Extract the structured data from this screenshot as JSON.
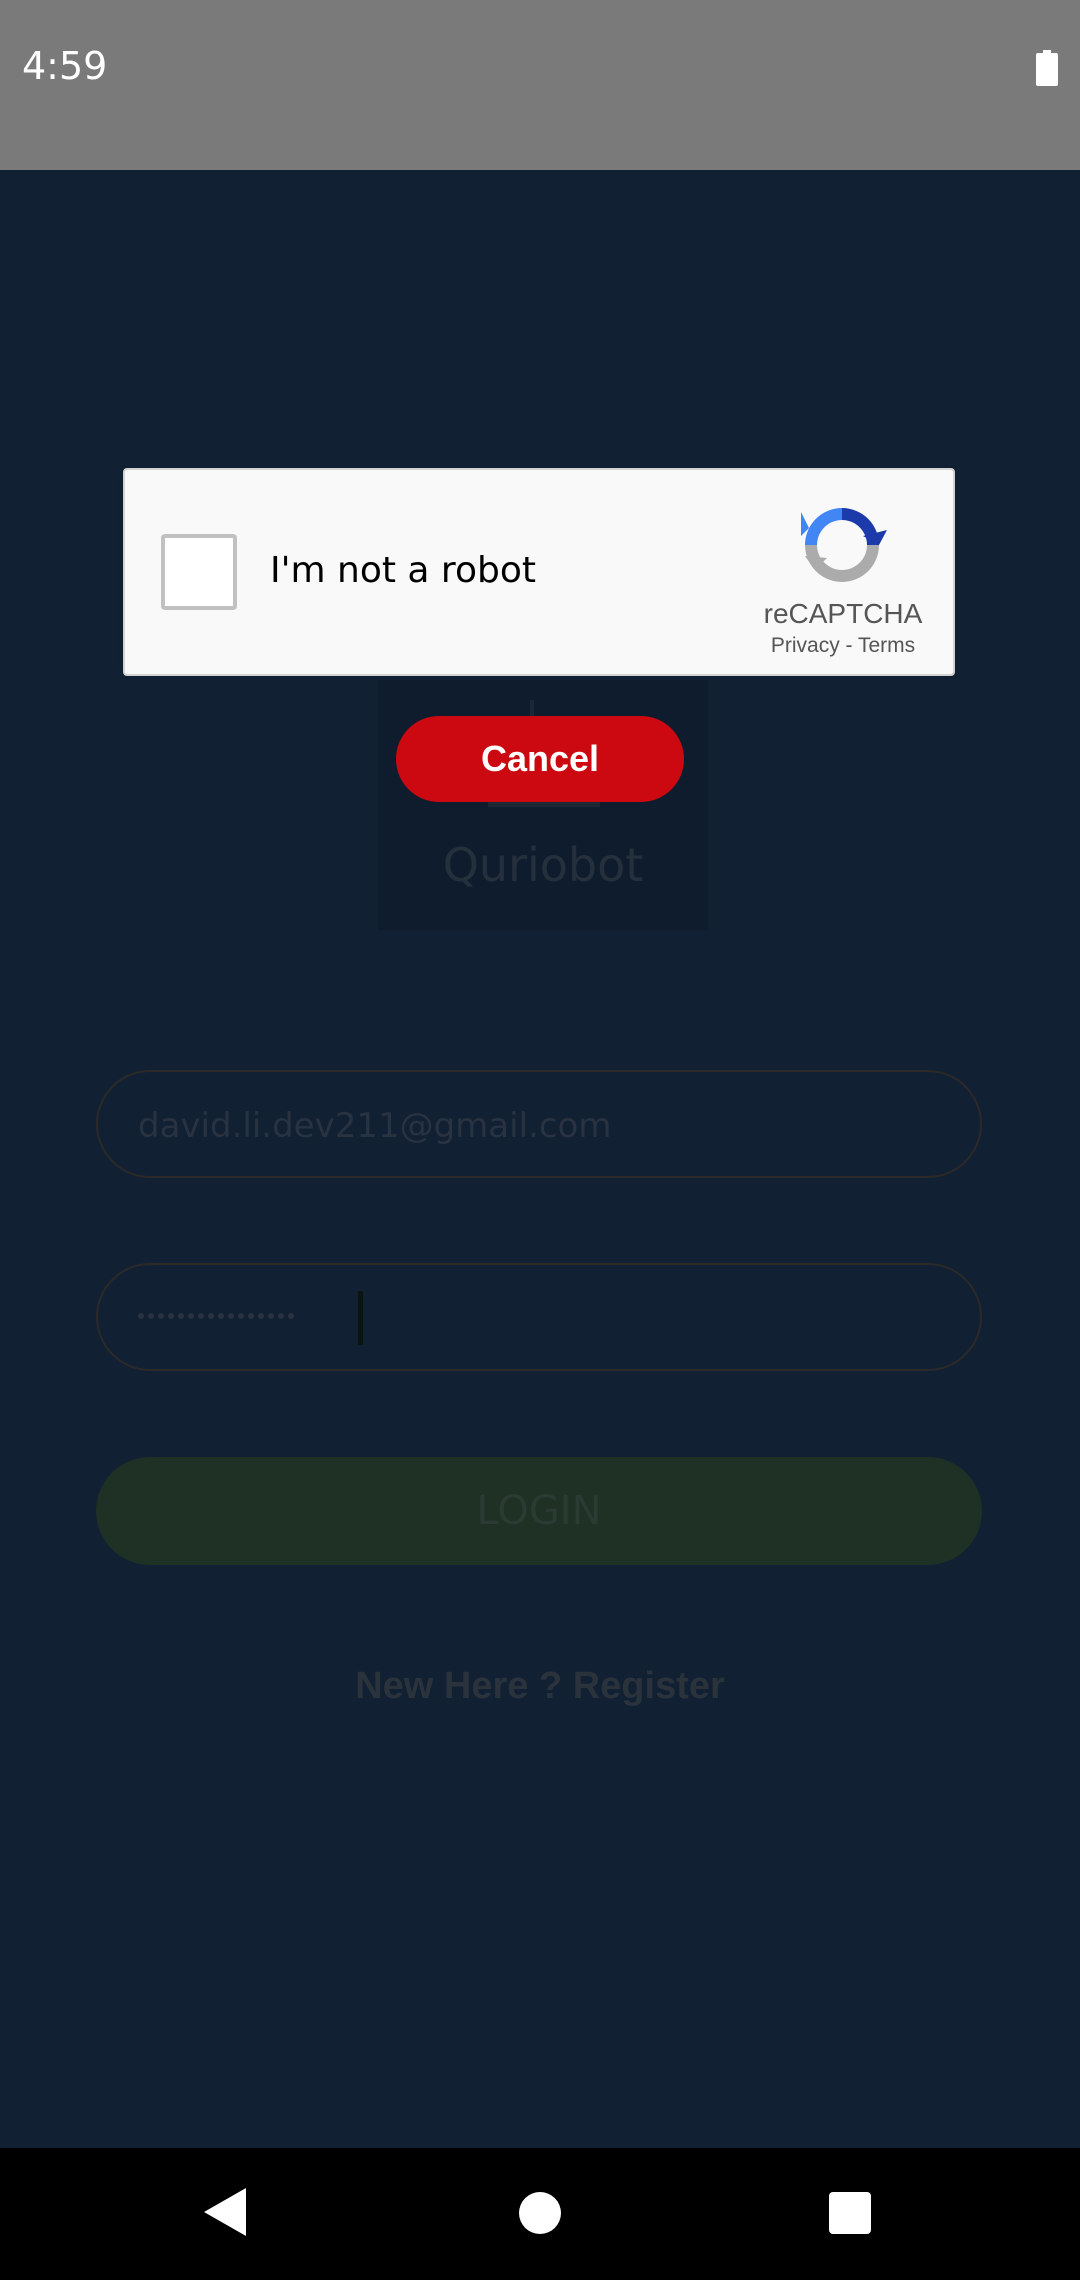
{
  "status_bar": {
    "time": "4:59",
    "icons": [
      "battery-icon"
    ]
  },
  "app": {
    "logo_text": "Quriobot",
    "email_value": "david.li.dev211@gmail.com",
    "password_mask_length": 16,
    "login_label": "LOGIN",
    "register_text": "New Here ? Register"
  },
  "captcha": {
    "label": "I'm not a robot",
    "brand": "reCAPTCHA",
    "links_text": "Privacy - Terms",
    "checked": false,
    "cancel_label": "Cancel"
  },
  "nav_bar": {
    "icons": [
      "back-icon",
      "home-icon",
      "recents-icon"
    ]
  },
  "colors": {
    "page_background": "#122034",
    "status_bar": "#7a7a7a",
    "cancel_button": "#cc0910",
    "login_button": "#1f3025",
    "captcha_background": "#f9f9f9"
  }
}
